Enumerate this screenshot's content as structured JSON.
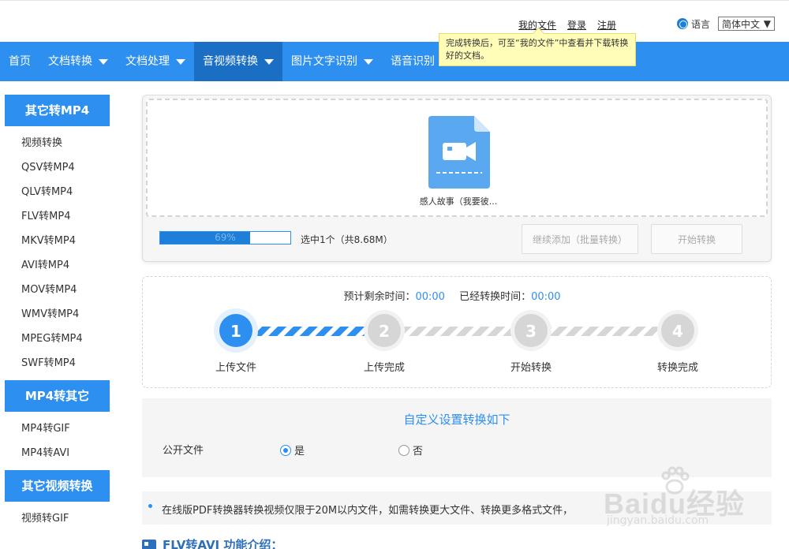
{
  "header": {
    "links": [
      "我的文件",
      "登录",
      "注册"
    ],
    "language_label": "语言",
    "language_value": "简体中文"
  },
  "tooltip": {
    "text": "完成转换后，可至“我的文件”中查看并下载转换好的文档。"
  },
  "nav": {
    "items": [
      {
        "label": "首页",
        "dropdown": false
      },
      {
        "label": "文档转换",
        "dropdown": true
      },
      {
        "label": "文档处理",
        "dropdown": true
      },
      {
        "label": "音视频转换",
        "dropdown": true,
        "active": true
      },
      {
        "label": "图片文字识别",
        "dropdown": true
      },
      {
        "label": "语音识别",
        "dropdown": true
      }
    ]
  },
  "sidebar": {
    "groups": [
      {
        "title": "其它转MP4",
        "items": [
          "视频转换",
          "QSV转MP4",
          "QLV转MP4",
          "FLV转MP4",
          "MKV转MP4",
          "AVI转MP4",
          "MOV转MP4",
          "WMV转MP4",
          "MPEG转MP4",
          "SWF转MP4"
        ]
      },
      {
        "title": "MP4转其它",
        "items": [
          "MP4转GIF",
          "MP4转AVI"
        ]
      },
      {
        "title": "其它视频转换",
        "items": [
          "视频转GIF"
        ]
      }
    ]
  },
  "upload": {
    "file_name": "感人故事（我要彼...",
    "progress_percent": 69,
    "progress_label": "69%",
    "selected_info": "选中1个（共8.68M）",
    "add_button": "继续添加（批量转换）",
    "start_button": "开始转换"
  },
  "timeline": {
    "remaining_label": "预计剩余时间：",
    "remaining_value": "00:00",
    "elapsed_label": "已经转换时间：",
    "elapsed_value": "00:00",
    "steps": [
      {
        "num": "1",
        "label": "上传文件",
        "active": true
      },
      {
        "num": "2",
        "label": "上传完成",
        "active": false
      },
      {
        "num": "3",
        "label": "开始转换",
        "active": false
      },
      {
        "num": "4",
        "label": "转换完成",
        "active": false
      }
    ]
  },
  "settings": {
    "title": "自定义设置转换如下",
    "public_label": "公开文件",
    "option_yes": "是",
    "option_no": "否",
    "selected": "是"
  },
  "notice": {
    "text": "在线版PDF转换器转换视频仅限于20M以内文件，如需转换更大文件、转换更多格式文件，"
  },
  "intro": {
    "title": "FLV转AVI 功能介绍："
  },
  "watermark": {
    "brand": "Baidu经验",
    "url": "jingyan.baidu.com"
  },
  "colors": {
    "primary": "#2d8ff0",
    "nav_active": "#1a6fc4",
    "tooltip_bg": "#fffdb8"
  }
}
